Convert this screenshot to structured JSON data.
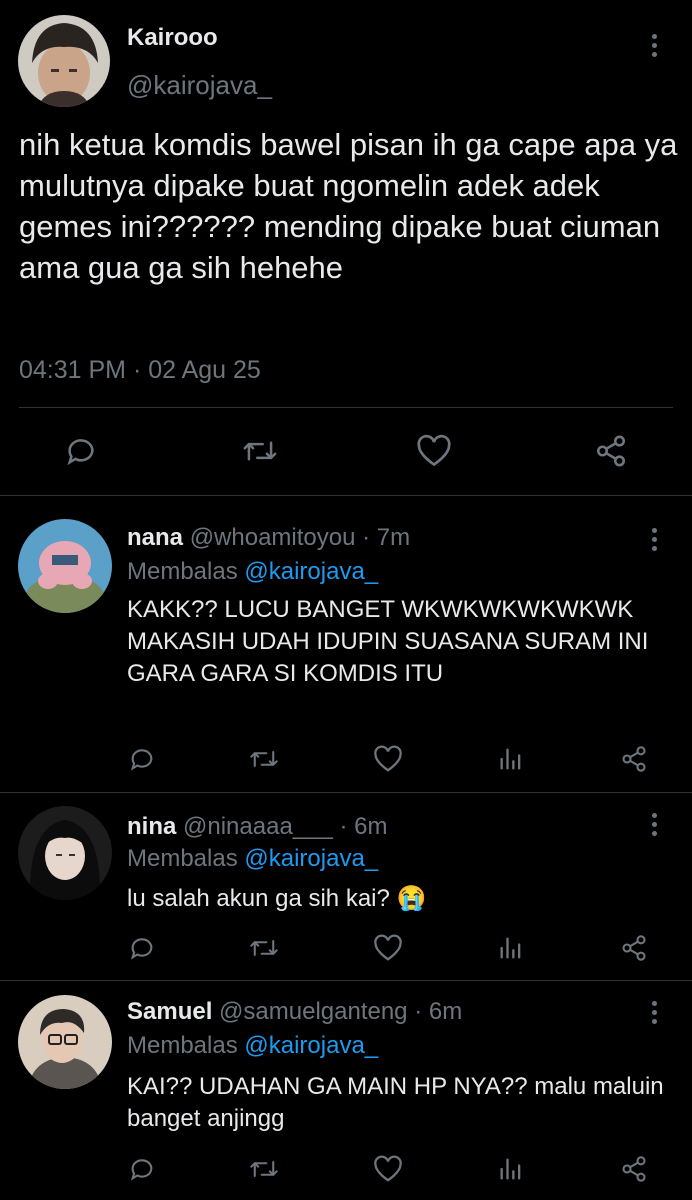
{
  "main_tweet": {
    "display_name": "Kairooo",
    "handle": "@kairojava_",
    "text": "nih ketua komdis bawel pisan ih ga cape apa ya mulutnya dipake buat ngomelin adek adek gemes ini?????? mending dipake buat ciuman ama gua ga sih hehehe",
    "timestamp": "04:31 PM · 02 Agu 25",
    "actions": [
      "reply-icon",
      "retweet-icon",
      "like-icon",
      "share-icon"
    ]
  },
  "replies": [
    {
      "display_name": "nana",
      "handle": "@whoamitoyou",
      "time": "· 7m",
      "replying_label": "Membalas",
      "replying_to": "@kairojava_",
      "text": "KAKK?? LUCU BANGET WKWKWKWKWKWK MAKASIH UDAH IDUPIN SUASANA SURAM INI GARA GARA SI KOMDIS ITU"
    },
    {
      "display_name": "nina",
      "handle": "@ninaaaa___",
      "time": "· 6m",
      "replying_label": "Membalas",
      "replying_to": "@kairojava_",
      "text": "lu salah akun ga sih kai? 😭"
    },
    {
      "display_name": "Samuel",
      "handle": "@samuelganteng",
      "time": "· 6m",
      "replying_label": "Membalas",
      "replying_to": "@kairojava_",
      "text": "KAI?? UDAHAN GA MAIN HP NYA?? malu maluin banget anjingg"
    }
  ],
  "colors": {
    "background": "#000000",
    "text": "#e7e9ea",
    "muted": "#6e767d",
    "link": "#1d9bf0",
    "divider": "#2f3336"
  }
}
